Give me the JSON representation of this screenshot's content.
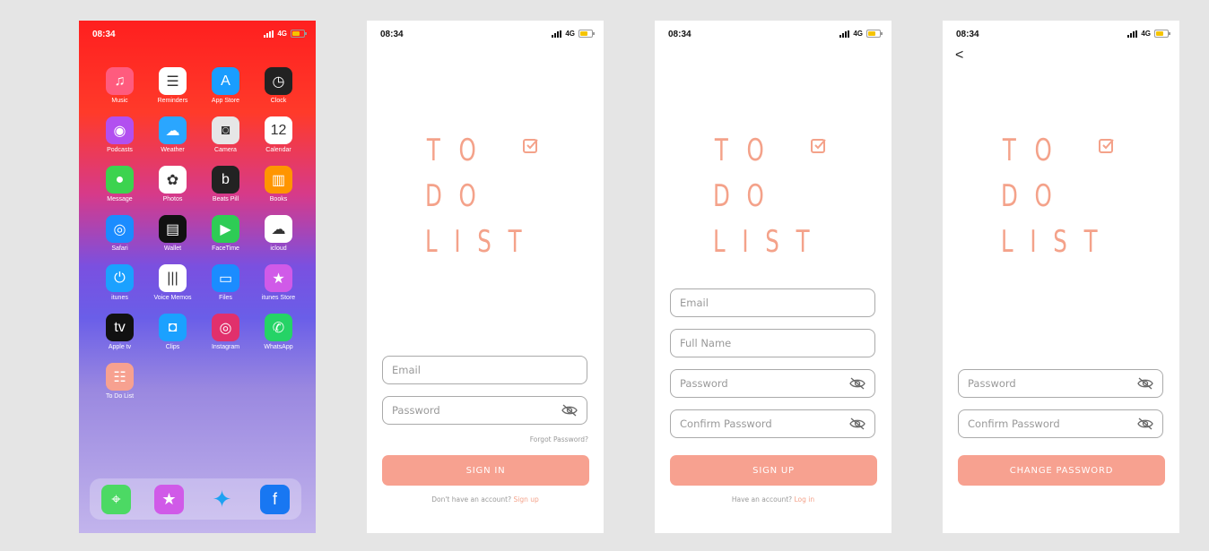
{
  "status": {
    "time": "08:34",
    "network": "4G"
  },
  "home": {
    "apps": [
      {
        "label": "Music",
        "icon": "♫",
        "color": "#ff5b7e"
      },
      {
        "label": "Reminders",
        "icon": "☰",
        "color": "#ffffff"
      },
      {
        "label": "App Store",
        "icon": "A",
        "color": "#1a9dff"
      },
      {
        "label": "Clock",
        "icon": "◷",
        "color": "#222222"
      },
      {
        "label": "Podcasts",
        "icon": "◉",
        "color": "#b24ff0"
      },
      {
        "label": "Weather",
        "icon": "☁",
        "color": "#2aa6ff"
      },
      {
        "label": "Camera",
        "icon": "◙",
        "color": "#e6e6e6"
      },
      {
        "label": "Calendar",
        "icon": "12",
        "color": "#ffffff"
      },
      {
        "label": "Message",
        "icon": "●",
        "color": "#3cd34f"
      },
      {
        "label": "Photos",
        "icon": "✿",
        "color": "#ffffff"
      },
      {
        "label": "Beats Pill",
        "icon": "b",
        "color": "#222222"
      },
      {
        "label": "Books",
        "icon": "▥",
        "color": "#ff9500"
      },
      {
        "label": "Safari",
        "icon": "◎",
        "color": "#1b8cff"
      },
      {
        "label": "Wallet",
        "icon": "▤",
        "color": "#111111"
      },
      {
        "label": "FaceTime",
        "icon": "▶",
        "color": "#2ecc55"
      },
      {
        "label": "icloud",
        "icon": "☁",
        "color": "#ffffff"
      },
      {
        "label": "itunes",
        "icon": "⏻",
        "color": "#1ba1ff"
      },
      {
        "label": "Voice Memos",
        "icon": "|||",
        "color": "#ffffff"
      },
      {
        "label": "Files",
        "icon": "▭",
        "color": "#1b8cff"
      },
      {
        "label": "itunes Store",
        "icon": "★",
        "color": "#d05ae8"
      },
      {
        "label": "Apple tv",
        "icon": "tv",
        "color": "#111111"
      },
      {
        "label": "Clips",
        "icon": "◘",
        "color": "#1ba1ff"
      },
      {
        "label": "Instagram",
        "icon": "◎",
        "color": "#e1306c"
      },
      {
        "label": "WhatsApp",
        "icon": "✆",
        "color": "#25d366"
      },
      {
        "label": "To Do List",
        "icon": "☷",
        "color": "#f7a190"
      }
    ],
    "dock": [
      {
        "icon": "⌖",
        "color": "#4cd964"
      },
      {
        "icon": "★",
        "color": "#d05ae8"
      },
      {
        "icon": "✦",
        "color": "transparent"
      },
      {
        "icon": "f",
        "color": "#1877f2"
      }
    ]
  },
  "logo": {
    "row1": [
      "T",
      "O"
    ],
    "row2": [
      "D",
      "O"
    ],
    "row3": [
      "L",
      "I",
      "S",
      "T"
    ]
  },
  "signin": {
    "email": "Email",
    "password": "Password",
    "forgot": "Forgot Password?",
    "button": "SIGN IN",
    "prompt": "Don't have an account?",
    "link": "Sign up"
  },
  "signup": {
    "email": "Email",
    "fullname": "Full Name",
    "password": "Password",
    "confirm": "Confirm Password",
    "button": "SIGN UP",
    "prompt": "Have an account?",
    "link": "Log in"
  },
  "change": {
    "back": "<",
    "password": "Password",
    "confirm": "Confirm Password",
    "button": "CHANGE PASSWORD"
  }
}
